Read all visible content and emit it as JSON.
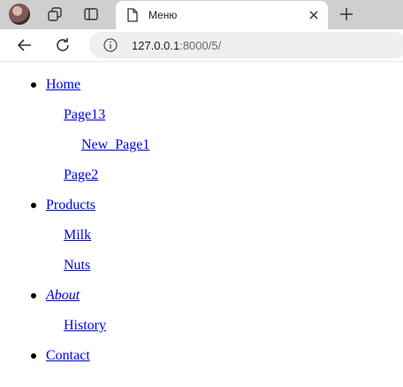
{
  "tab": {
    "title": "Меню"
  },
  "address": {
    "host": "127.0.0.1",
    "rest": ":8000/5/"
  },
  "menu": {
    "home": "Home",
    "page13": "Page13",
    "new_page1": "New_Page1",
    "page2": "Page2",
    "products": "Products",
    "milk": "Milk",
    "nuts": "Nuts",
    "about": "About",
    "history": "History",
    "contact": "Contact"
  }
}
